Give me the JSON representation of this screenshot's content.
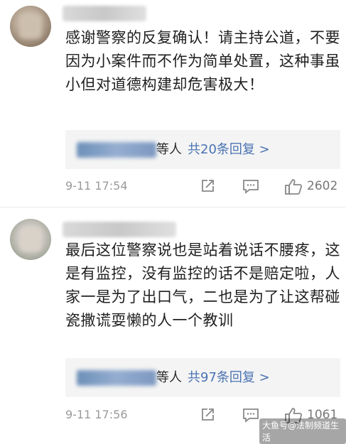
{
  "comments": [
    {
      "body": "感谢警察的反复确认！请主持公道，不要因为小案件而不作为简单处置，这种事虽小但对道德构建却危害极大！",
      "replies": {
        "etc_label": "等人",
        "count_label": "共20条回复 >"
      },
      "time": "9-11 17:54",
      "likes": "2602"
    },
    {
      "body": "最后这位警察说也是站着说话不腰疼，这是有监控，没有监控的话不是赔定啦，人家一是为了出口气，二也是为了让这帮碰瓷撒谎耍懒的人一个教训",
      "replies": {
        "etc_label": "等人",
        "count_label": "共97条回复 >"
      },
      "time": "9-11 17:56",
      "likes": "1061"
    }
  ],
  "watermark": "大鱼号@法制频道生活",
  "icons": {
    "share": "share-icon",
    "comment": "comment-icon",
    "like": "thumbs-up-icon"
  },
  "colors": {
    "link": "#4a73b3",
    "meta": "#9a9a9a",
    "reply_bg": "#f4f4f4"
  }
}
